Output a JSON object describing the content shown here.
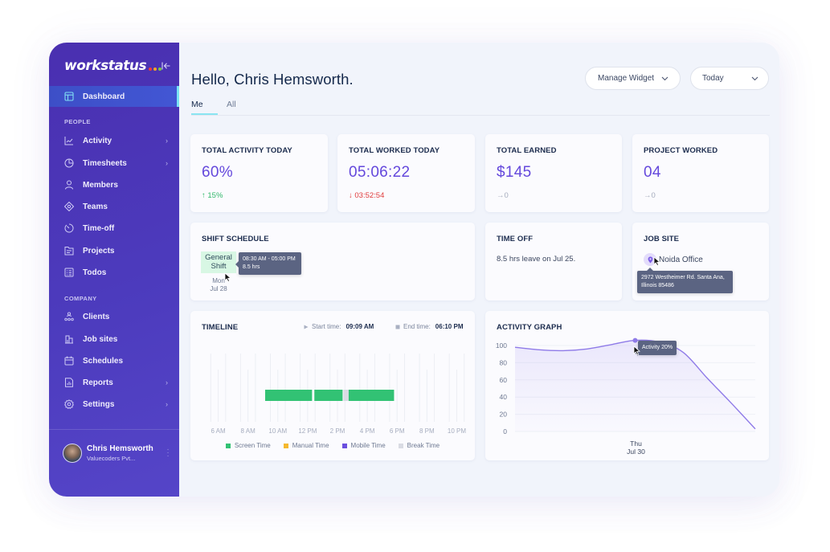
{
  "brand": {
    "name": "workstatus",
    "dot_colors": [
      "#ef3b3b",
      "#f5a623",
      "#7ac943"
    ]
  },
  "sidebar": {
    "active_item": {
      "label": "Dashboard",
      "icon": "layout-icon"
    },
    "sections": [
      {
        "title": "PEOPLE",
        "items": [
          {
            "label": "Activity",
            "icon": "activity-chart-icon",
            "has_submenu": true
          },
          {
            "label": "Timesheets",
            "icon": "pie-clock-icon",
            "has_submenu": true
          },
          {
            "label": "Members",
            "icon": "user-icon",
            "has_submenu": false
          },
          {
            "label": "Teams",
            "icon": "teams-icon",
            "has_submenu": false
          },
          {
            "label": "Time-off",
            "icon": "timer-icon",
            "has_submenu": false
          },
          {
            "label": "Projects",
            "icon": "folder-list-icon",
            "has_submenu": false
          },
          {
            "label": "Todos",
            "icon": "checklist-icon",
            "has_submenu": false
          }
        ]
      },
      {
        "title": "COMPANY",
        "items": [
          {
            "label": "Clients",
            "icon": "clients-icon",
            "has_submenu": false
          },
          {
            "label": "Job sites",
            "icon": "building-icon",
            "has_submenu": false
          },
          {
            "label": "Schedules",
            "icon": "calendar-icon",
            "has_submenu": false
          },
          {
            "label": "Reports",
            "icon": "report-icon",
            "has_submenu": true
          },
          {
            "label": "Settings",
            "icon": "gear-icon",
            "has_submenu": true
          }
        ]
      }
    ],
    "chevron": "›",
    "user": {
      "name": "Chris Hemsworth",
      "org": "Valuecoders Pvt..."
    }
  },
  "header": {
    "greeting": "Hello, Chris Hemsworth.",
    "tabs": [
      {
        "label": "Me",
        "active": true
      },
      {
        "label": "All",
        "active": false
      }
    ],
    "manage_widget_label": "Manage Widget",
    "date_filter": "Today"
  },
  "stats": [
    {
      "title": "TOTAL ACTIVITY TODAY",
      "value": "60%",
      "delta": "15%",
      "trend": "up",
      "arrow": "↑"
    },
    {
      "title": "TOTAL WORKED TODAY",
      "value": "05:06:22",
      "delta": "03:52:54",
      "trend": "down",
      "arrow": "↓"
    },
    {
      "title": "TOTAL EARNED",
      "value": "$145",
      "delta": "0",
      "trend": "flat",
      "arrow": "→"
    },
    {
      "title": "PROJECT WORKED",
      "value": "04",
      "delta": "0",
      "trend": "flat",
      "arrow": "→"
    }
  ],
  "shift_schedule": {
    "title": "SHIFT SCHEDULE",
    "shift_name_line1": "General",
    "shift_name_line2": "Shift",
    "day": "Mon",
    "date": "Jul 28",
    "tooltip_time": "08:30 AM - 05:00 PM",
    "tooltip_hours": "8.5 hrs"
  },
  "time_off": {
    "title": "TIME OFF",
    "text": "8.5 hrs leave on Jul 25."
  },
  "job_site": {
    "title": "JOB SITE",
    "name": "Noida Office",
    "address_line1": "2972 Westheimer Rd. Santa Ana,",
    "address_line2": "Illinois 85486"
  },
  "timeline": {
    "title": "TIMELINE",
    "start_label": "Start time:",
    "start_value": "09:09 AM",
    "end_label": "End time:",
    "end_value": "06:10 PM",
    "legend": [
      {
        "label": "Screen Time",
        "color": "#32c274"
      },
      {
        "label": "Manual Time",
        "color": "#f5b82e"
      },
      {
        "label": "Mobile Time",
        "color": "#6a4fdf"
      },
      {
        "label": "Break Time",
        "color": "#d9dbe3"
      }
    ]
  },
  "activity_graph": {
    "title": "ACTIVITY GRAPH",
    "tooltip": "Activity 20%",
    "x_day": "Thu",
    "x_date": "Jul 30"
  },
  "chart_data": [
    {
      "type": "bar",
      "title": "TIMELINE",
      "x_range_hours": [
        5,
        23
      ],
      "x_ticks": [
        {
          "label": "6 AM",
          "hour": 6
        },
        {
          "label": "8 AM",
          "hour": 8
        },
        {
          "label": "10 AM",
          "hour": 10
        },
        {
          "label": "12 PM",
          "hour": 12
        },
        {
          "label": "2 PM",
          "hour": 14
        },
        {
          "label": "4 PM",
          "hour": 16
        },
        {
          "label": "6 PM",
          "hour": 18
        },
        {
          "label": "8 PM",
          "hour": 20
        },
        {
          "label": "10 PM",
          "hour": 22
        }
      ],
      "segments": [
        {
          "kind": "Screen Time",
          "start": 9.15,
          "end": 12.35
        },
        {
          "kind": "Screen Time",
          "start": 12.45,
          "end": 14.4
        },
        {
          "kind": "Break Time",
          "start": 14.4,
          "end": 14.75
        },
        {
          "kind": "Screen Time",
          "start": 14.75,
          "end": 17.85
        }
      ]
    },
    {
      "type": "area",
      "title": "ACTIVITY GRAPH",
      "xlabel": "Thu Jul 30",
      "ylabel": "",
      "ylim": [
        0,
        100
      ],
      "y_ticks": [
        0,
        20,
        40,
        60,
        80,
        100
      ],
      "grid": true,
      "x": [
        0,
        1,
        2,
        3,
        4,
        5,
        6,
        7,
        8,
        9,
        10
      ],
      "values": [
        98,
        95,
        94,
        96,
        101,
        106,
        104,
        92,
        62,
        33,
        3
      ],
      "highlight_index": 5,
      "highlight_label": "Activity 20%"
    }
  ]
}
